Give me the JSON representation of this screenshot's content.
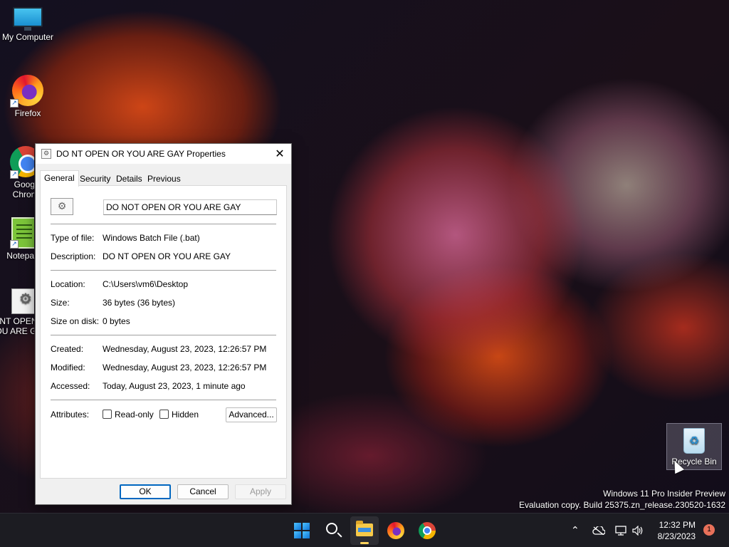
{
  "desktop": {
    "icons": [
      {
        "label": "My Computer",
        "icon": "monitor-icon"
      },
      {
        "label": "Firefox",
        "icon": "firefox-icon"
      },
      {
        "label": "Google Chrome",
        "icon": "chrome-icon"
      },
      {
        "label": "Notepad++",
        "icon": "notepad-icon"
      },
      {
        "label": "DO NT OPEN OR YOU ARE GAY",
        "icon": "batch-file-icon"
      }
    ],
    "recycle_bin_label": "Recycle Bin",
    "watermark_line1": "Windows 11 Pro Insider Preview",
    "watermark_line2": "Evaluation copy. Build 25375.zn_release.230520-1632"
  },
  "dialog": {
    "title": "DO NT OPEN OR YOU ARE GAY Properties",
    "close_glyph": "✕",
    "tabs": [
      "General",
      "Security",
      "Details",
      "Previous Versions"
    ],
    "active_tab": "General",
    "file_name": "DO NOT OPEN OR YOU ARE GAY",
    "fields": {
      "type_label": "Type of file:",
      "type_value": "Windows Batch File (.bat)",
      "description_label": "Description:",
      "description_value": "DO NT OPEN OR YOU ARE GAY",
      "location_label": "Location:",
      "location_value": "C:\\Users\\vm6\\Desktop",
      "size_label": "Size:",
      "size_value": "36 bytes (36 bytes)",
      "size_on_disk_label": "Size on disk:",
      "size_on_disk_value": "0 bytes",
      "created_label": "Created:",
      "created_value": "Wednesday, August 23, 2023, 12:26:57 PM",
      "modified_label": "Modified:",
      "modified_value": "Wednesday, August 23, 2023, 12:26:57 PM",
      "accessed_label": "Accessed:",
      "accessed_value": "Today, August 23, 2023, 1 minute ago",
      "attributes_label": "Attributes:"
    },
    "attributes": {
      "readonly_label": "Read-only",
      "readonly_checked": false,
      "hidden_label": "Hidden",
      "hidden_checked": false,
      "advanced_label": "Advanced..."
    },
    "buttons": {
      "ok": "OK",
      "cancel": "Cancel",
      "apply": "Apply"
    }
  },
  "taskbar": {
    "items": [
      "start-icon",
      "search-icon",
      "file-explorer-icon",
      "firefox-icon",
      "chrome-icon"
    ],
    "active_item": "file-explorer-icon",
    "tray": {
      "chevron_glyph": "⌃",
      "clock_time": "12:32 PM",
      "clock_date": "8/23/2023",
      "notification_count": "1"
    }
  },
  "colors": {
    "accent": "#0067c0",
    "taskbar_bg": "#1c1c22",
    "dialog_bg": "#f0f0f0",
    "notification_badge": "#e8715a"
  }
}
